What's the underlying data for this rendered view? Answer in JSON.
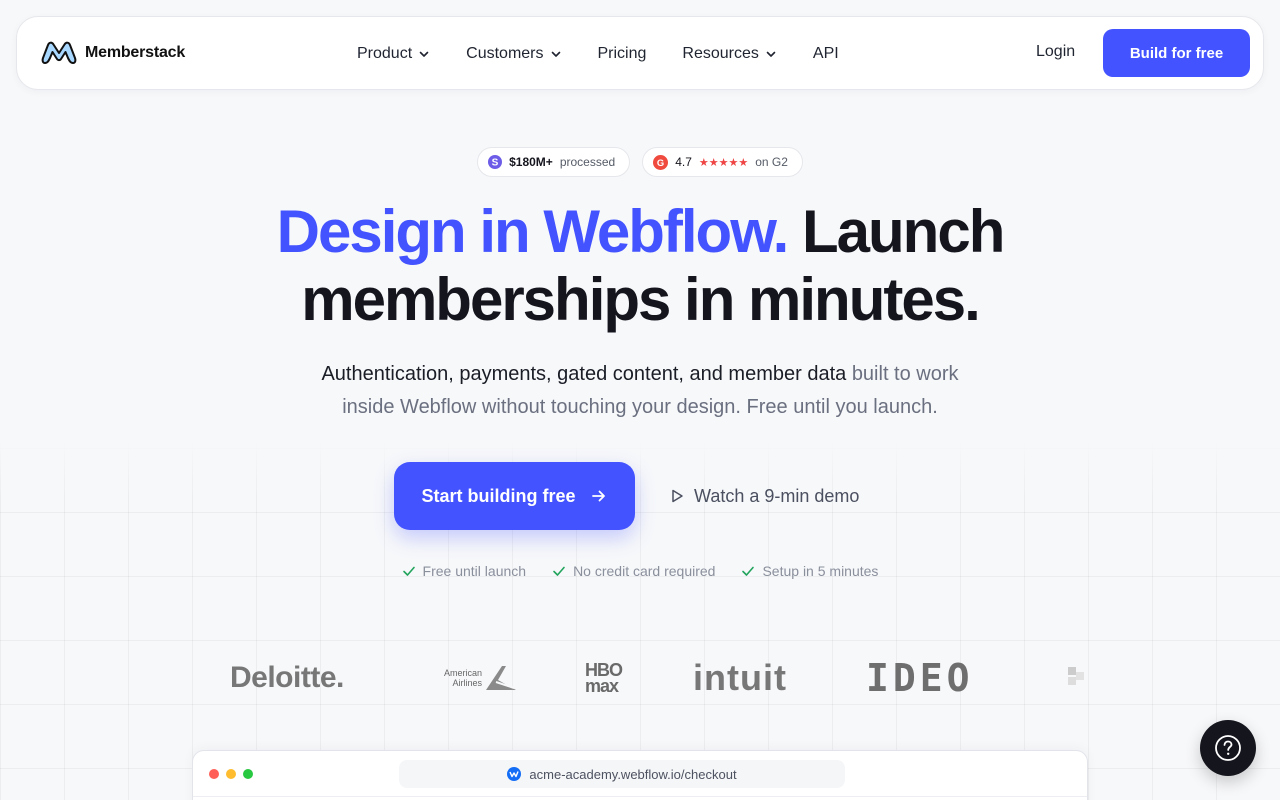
{
  "nav": {
    "brand": "Memberstack",
    "links": [
      {
        "label": "Product",
        "dropdown": true
      },
      {
        "label": "Customers",
        "dropdown": true
      },
      {
        "label": "Pricing",
        "dropdown": false
      },
      {
        "label": "Resources",
        "dropdown": true
      },
      {
        "label": "API",
        "dropdown": false
      }
    ],
    "login": "Login",
    "cta": "Build for free"
  },
  "badges": {
    "processed_value": "$180M+",
    "processed_label": "processed",
    "rating": "4.7",
    "stars": "★★★★★",
    "rating_suffix": "on G2"
  },
  "hero": {
    "headline_accent": "Design in Webflow.",
    "headline_rest_1": "Launch",
    "headline_line2": "memberships in minutes.",
    "sub_dark": "Authentication, payments, gated content, and member data",
    "sub_rest": "built to work inside Webflow without touching your design. Free until you launch.",
    "cta_primary": "Start building free",
    "cta_secondary": "Watch a 9-min demo",
    "checks": [
      "Free until launch",
      "No credit card required",
      "Setup in 5 minutes"
    ]
  },
  "logos": {
    "deloitte": "Deloitte",
    "american_airlines_1": "American",
    "american_airlines_2": "Airlines",
    "hbo": "HBO",
    "max": "max",
    "intuit": "intuit",
    "ideo": "IDEO"
  },
  "browser": {
    "url": "acme-academy.webflow.io/checkout"
  },
  "colors": {
    "accent": "#4353ff",
    "dark": "#15151e",
    "check": "#22a45d",
    "traffic_red": "#ff5f57",
    "traffic_yellow": "#febc2e",
    "traffic_green": "#28c840"
  },
  "icons": {
    "brand": "memberstack-logo-icon",
    "dropdown": "chevron-down-icon",
    "arrow": "arrow-right-icon",
    "play": "play-icon",
    "check": "check-icon",
    "help": "question-mark-icon"
  }
}
